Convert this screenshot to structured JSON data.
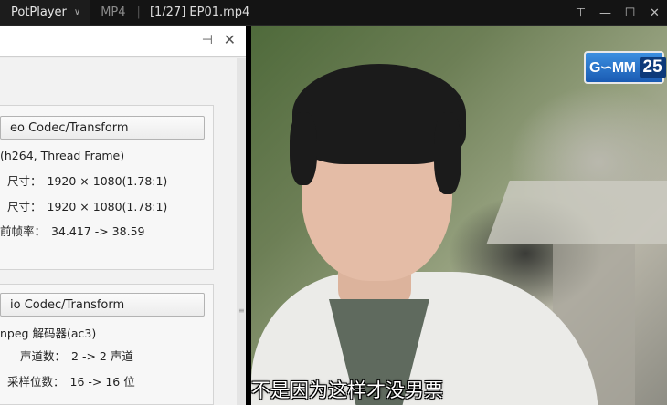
{
  "titlebar": {
    "app_name": "PotPlayer",
    "format": "MP4",
    "separator": "|",
    "file_title": "[1/27] EP01.mp4",
    "chevron_glyph": "∨",
    "controls": {
      "pin": "⊤",
      "minimize": "—",
      "maximize": "☐",
      "close": "✕"
    }
  },
  "panel": {
    "pin_glyph": "⊣",
    "close_glyph": "✕",
    "video": {
      "codec_button": "eo Codec/Transform",
      "decoder": "(h264, Thread Frame)",
      "rows": [
        {
          "label": "尺寸：",
          "value": "1920 × 1080(1.78:1)"
        },
        {
          "label": "尺寸：",
          "value": "1920 × 1080(1.78:1)"
        },
        {
          "label": "前帧率：",
          "value": "34.417 -> 38.59"
        }
      ]
    },
    "audio": {
      "codec_button": "io Codec/Transform",
      "decoder": "npeg 解码器(ac3)",
      "rows": [
        {
          "label": "声道数：",
          "value": "2 -> 2 声道"
        },
        {
          "label": "采样位数：",
          "value": "16 -> 16 位"
        }
      ]
    }
  },
  "video": {
    "logo_text": "G∽MM",
    "logo_number": "25",
    "subtitle": "不是因为这样才没男票"
  },
  "colors": {
    "titlebar_bg": "#141414",
    "panel_bg": "#ededed",
    "logo_blue": "#2a6fcc"
  }
}
